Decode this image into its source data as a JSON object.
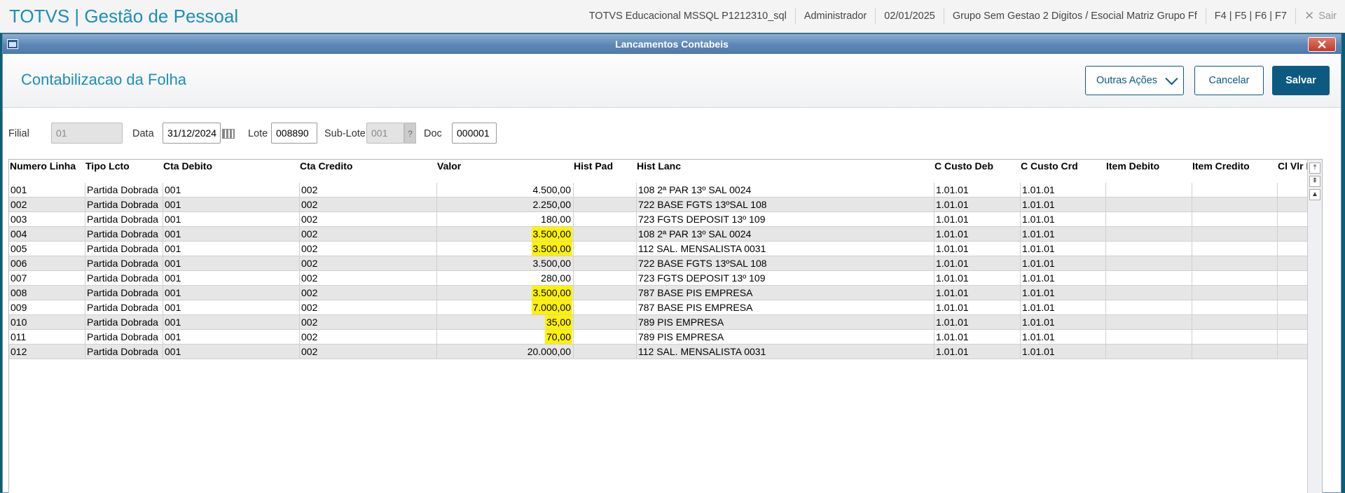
{
  "app": {
    "title": "TOTVS | Gestão de Pessoal",
    "environment": "TOTVS Educacional MSSQL P1212310_sql",
    "user": "Administrador",
    "date": "02/01/2025",
    "company": "Grupo Sem Gestao 2 Digitos / Esocial Matriz Grupo Ff",
    "shortcuts": "F4 | F5 | F6 | F7",
    "exit_label": "Sair"
  },
  "dialog": {
    "title": "Lancamentos Contabeis",
    "page_title": "Contabilizacao da Folha",
    "buttons": {
      "other_actions": "Outras Ações",
      "cancel": "Cancelar",
      "save": "Salvar"
    }
  },
  "form": {
    "filial": {
      "label": "Filial",
      "value": "01"
    },
    "data": {
      "label": "Data",
      "value": "31/12/2024"
    },
    "lote": {
      "label": "Lote",
      "value": "008890"
    },
    "sublote": {
      "label": "Sub-Lote",
      "value": "001",
      "lookup": "?"
    },
    "doc": {
      "label": "Doc",
      "value": "000001"
    }
  },
  "grid": {
    "columns": [
      "Numero Linha",
      "Tipo Lcto",
      "Cta Debito",
      "Cta Credito",
      "Valor",
      "Hist Pad",
      "Hist Lanc",
      "C Custo Deb",
      "C Custo Crd",
      "Item Debito",
      "Item Credito",
      "Cl Vlr De"
    ],
    "rows": [
      {
        "num": "001",
        "tipo": "Partida Dobrada",
        "deb": "001",
        "cred": "002",
        "valor": "4.500,00",
        "hist_pad": "",
        "hist_lanc": "108 2ª PAR 13º SAL 0024",
        "cc_deb": "1.01.01",
        "cc_crd": "1.01.01",
        "highlighted": false
      },
      {
        "num": "002",
        "tipo": "Partida Dobrada",
        "deb": "001",
        "cred": "002",
        "valor": "2.250,00",
        "hist_pad": "",
        "hist_lanc": "722 BASE FGTS 13ºSAL 108",
        "cc_deb": "1.01.01",
        "cc_crd": "1.01.01",
        "highlighted": false
      },
      {
        "num": "003",
        "tipo": "Partida Dobrada",
        "deb": "001",
        "cred": "002",
        "valor": "180,00",
        "hist_pad": "",
        "hist_lanc": "723 FGTS DEPOSIT 13º 109",
        "cc_deb": "1.01.01",
        "cc_crd": "1.01.01",
        "highlighted": false
      },
      {
        "num": "004",
        "tipo": "Partida Dobrada",
        "deb": "001",
        "cred": "002",
        "valor": "3.500,00",
        "hist_pad": "",
        "hist_lanc": "108 2ª PAR 13º SAL 0024",
        "cc_deb": "1.01.01",
        "cc_crd": "1.01.01",
        "highlighted": true
      },
      {
        "num": "005",
        "tipo": "Partida Dobrada",
        "deb": "001",
        "cred": "002",
        "valor": "3.500,00",
        "hist_pad": "",
        "hist_lanc": "112 SAL. MENSALISTA 0031",
        "cc_deb": "1.01.01",
        "cc_crd": "1.01.01",
        "highlighted": true
      },
      {
        "num": "006",
        "tipo": "Partida Dobrada",
        "deb": "001",
        "cred": "002",
        "valor": "3.500,00",
        "hist_pad": "",
        "hist_lanc": "722 BASE FGTS 13ºSAL 108",
        "cc_deb": "1.01.01",
        "cc_crd": "1.01.01",
        "highlighted": false
      },
      {
        "num": "007",
        "tipo": "Partida Dobrada",
        "deb": "001",
        "cred": "002",
        "valor": "280,00",
        "hist_pad": "",
        "hist_lanc": "723 FGTS DEPOSIT 13º 109",
        "cc_deb": "1.01.01",
        "cc_crd": "1.01.01",
        "highlighted": false
      },
      {
        "num": "008",
        "tipo": "Partida Dobrada",
        "deb": "001",
        "cred": "002",
        "valor": "3.500,00",
        "hist_pad": "",
        "hist_lanc": "787 BASE PIS EMPRESA",
        "cc_deb": "1.01.01",
        "cc_crd": "1.01.01",
        "highlighted": true
      },
      {
        "num": "009",
        "tipo": "Partida Dobrada",
        "deb": "001",
        "cred": "002",
        "valor": "7.000,00",
        "hist_pad": "",
        "hist_lanc": "787 BASE PIS EMPRESA",
        "cc_deb": "1.01.01",
        "cc_crd": "1.01.01",
        "highlighted": true
      },
      {
        "num": "010",
        "tipo": "Partida Dobrada",
        "deb": "001",
        "cred": "002",
        "valor": "35,00",
        "hist_pad": "",
        "hist_lanc": "789 PIS EMPRESA",
        "cc_deb": "1.01.01",
        "cc_crd": "1.01.01",
        "highlighted": true
      },
      {
        "num": "011",
        "tipo": "Partida Dobrada",
        "deb": "001",
        "cred": "002",
        "valor": "70,00",
        "hist_pad": "",
        "hist_lanc": "789 PIS EMPRESA",
        "cc_deb": "1.01.01",
        "cc_crd": "1.01.01",
        "highlighted": true
      },
      {
        "num": "012",
        "tipo": "Partida Dobrada",
        "deb": "001",
        "cred": "002",
        "valor": "20.000,00",
        "hist_pad": "",
        "hist_lanc": "112 SAL. MENSALISTA 0031",
        "cc_deb": "1.01.01",
        "cc_crd": "1.01.01",
        "highlighted": false
      }
    ]
  },
  "colors": {
    "brand": "#1b8fb8",
    "primary_button": "#0c5a82",
    "highlight": "#fff200"
  }
}
